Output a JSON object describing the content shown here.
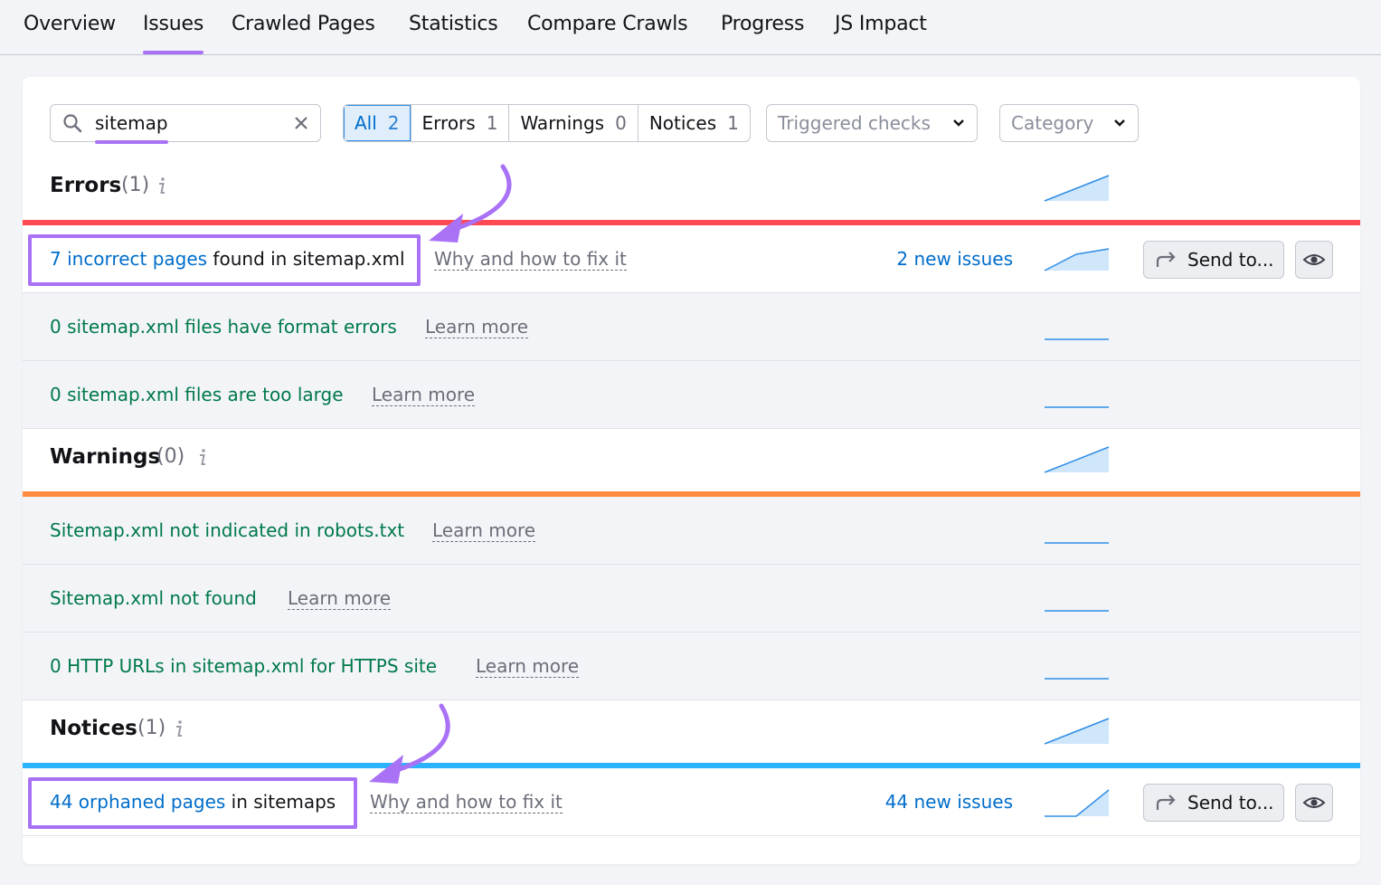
{
  "tabs": [
    {
      "label": "Overview"
    },
    {
      "label": "Issues"
    },
    {
      "label": "Crawled Pages"
    },
    {
      "label": "Statistics"
    },
    {
      "label": "Compare Crawls"
    },
    {
      "label": "Progress"
    },
    {
      "label": "JS Impact"
    }
  ],
  "active_tab": "Issues",
  "filters": {
    "search_value": "sitemap",
    "segments": [
      {
        "label": "All",
        "count": "2"
      },
      {
        "label": "Errors",
        "count": "1"
      },
      {
        "label": "Warnings",
        "count": "0"
      },
      {
        "label": "Notices",
        "count": "1"
      }
    ],
    "triggered_checks": "Triggered checks",
    "category": "Category"
  },
  "groups": {
    "errors": {
      "title": "Errors",
      "count": "(1)",
      "color": "#ff4953"
    },
    "warnings": {
      "title": "Warnings",
      "count": "(0)",
      "color": "#ff8c43"
    },
    "notices": {
      "title": "Notices",
      "count": "(1)",
      "color": "#2bb3ff"
    }
  },
  "rows": {
    "incorrect_pages": {
      "link": "7 incorrect pages",
      "rest": " found in sitemap.xml",
      "help": "Why and how to fix it",
      "new_issues": "2 new issues",
      "send": "Send to..."
    },
    "format_errors": {
      "text": "0 sitemap.xml files have format errors",
      "help": "Learn more"
    },
    "too_large": {
      "text": "0 sitemap.xml files are too large",
      "help": "Learn more"
    },
    "not_in_robots": {
      "text": "Sitemap.xml not indicated in robots.txt",
      "help": "Learn more"
    },
    "not_found": {
      "text": "Sitemap.xml not found",
      "help": "Learn more"
    },
    "http_urls": {
      "text": "0 HTTP URLs in sitemap.xml for HTTPS site",
      "help": "Learn more"
    },
    "orphaned": {
      "link": "44 orphaned pages",
      "rest": " in sitemaps",
      "help": "Why and how to fix it",
      "new_issues": "44 new issues",
      "send": "Send to..."
    }
  },
  "colors": {
    "accent": "#a972f6",
    "link": "#006dca",
    "ok_text": "#00794b"
  }
}
